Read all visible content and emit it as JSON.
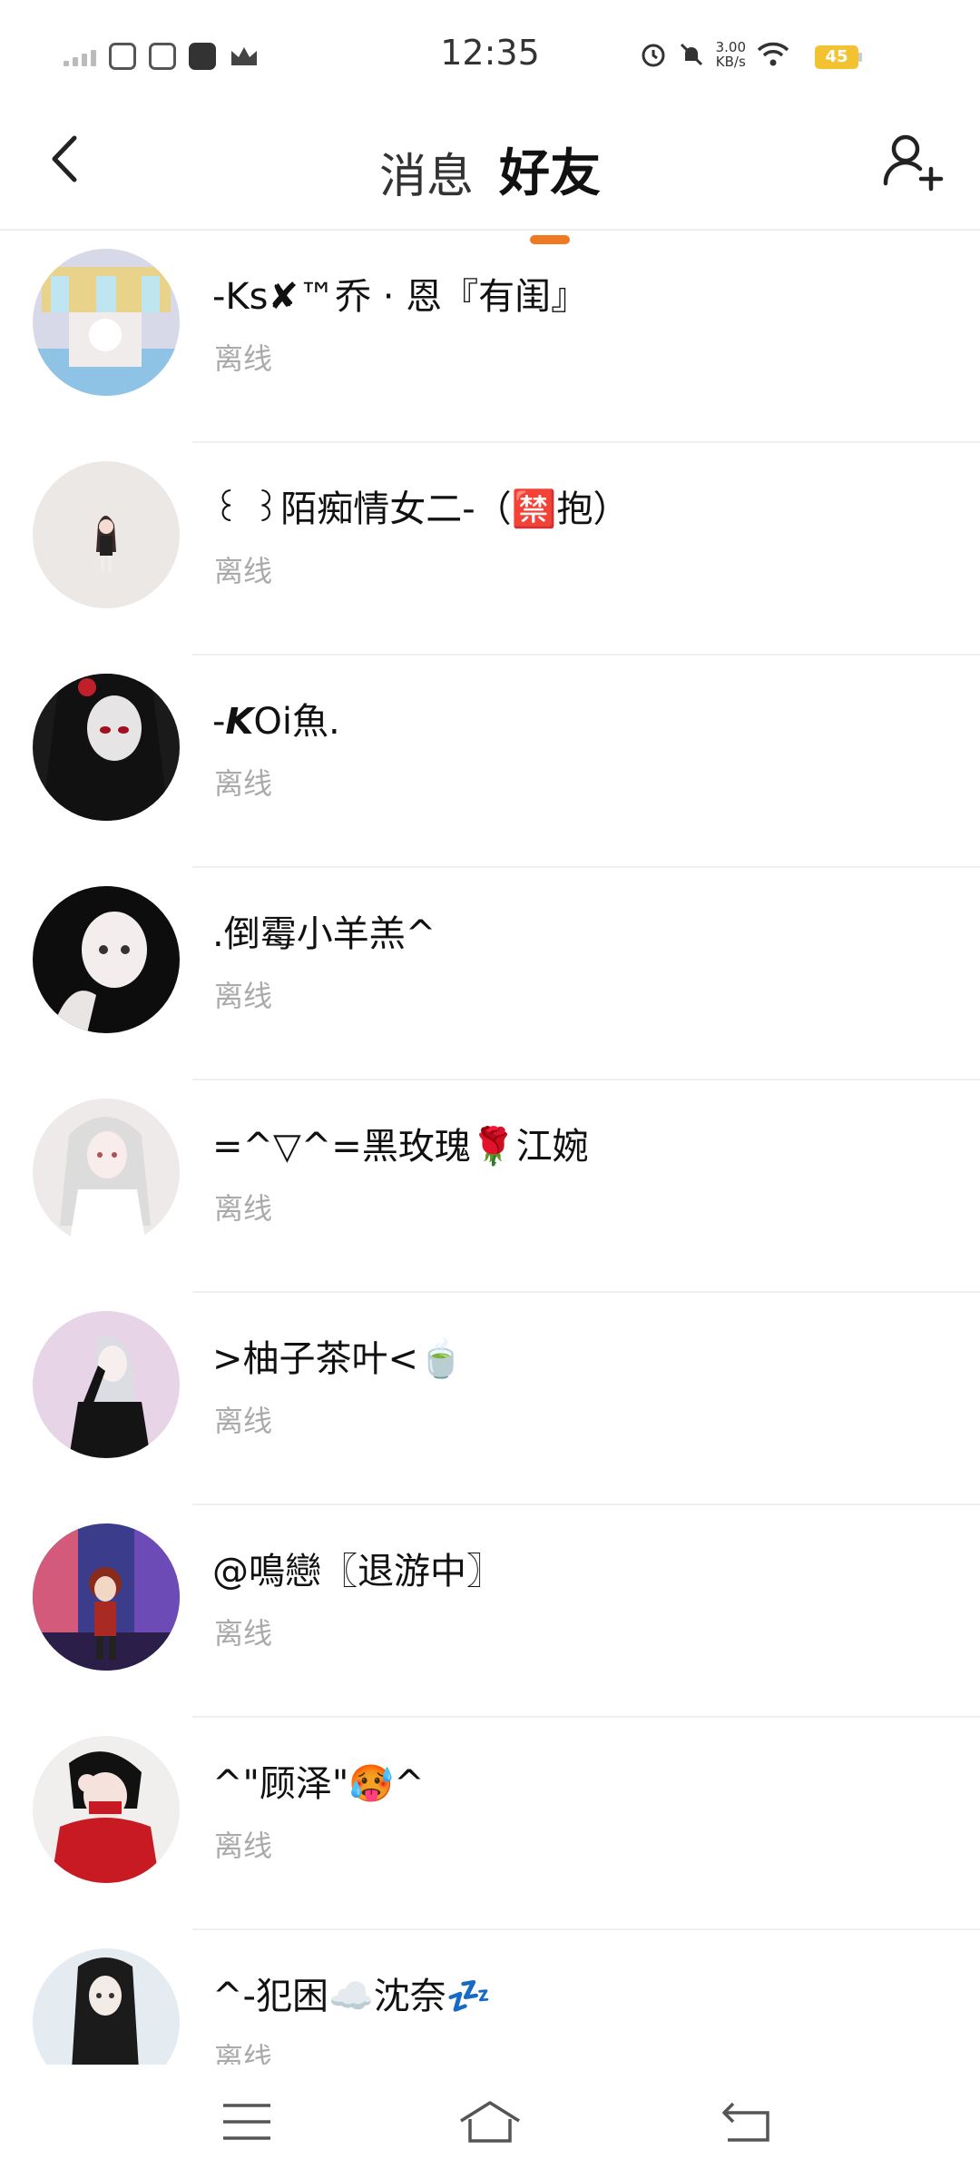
{
  "status_bar": {
    "time": "12:35",
    "net_speed_value": "3.00",
    "net_speed_unit": "KB/s",
    "battery": "45"
  },
  "header": {
    "tabs": [
      {
        "label": "消息",
        "active": false
      },
      {
        "label": "好友",
        "active": true
      }
    ],
    "accent_color": "#f07a24"
  },
  "friends": [
    {
      "name": "-Ks✘™乔 · 恩『有闺』",
      "status": "离线"
    },
    {
      "name": "꒰ ꒱陌痴情女二-（🈲抱）",
      "status": "离线"
    },
    {
      "name": "-𝙆Oi魚.",
      "status": "离线"
    },
    {
      "name": ".倒霉小羊羔^",
      "status": "离线"
    },
    {
      "name": "=^▽^=黑玫瑰🌹江婉",
      "status": "离线"
    },
    {
      "name": ">柚子茶叶<🍵",
      "status": "离线"
    },
    {
      "name": "@鳴戀〖退游中〗",
      "status": "离线"
    },
    {
      "name": "^\"顾泽\"🥵^",
      "status": "离线"
    },
    {
      "name": "^-犯困☁️沈奈💤",
      "status": "离线"
    }
  ],
  "icons": {
    "back": "chevron-left-icon",
    "add_friend": "add-user-icon",
    "nav_menu": "menu-icon",
    "nav_home": "home-icon",
    "nav_back": "return-icon"
  }
}
